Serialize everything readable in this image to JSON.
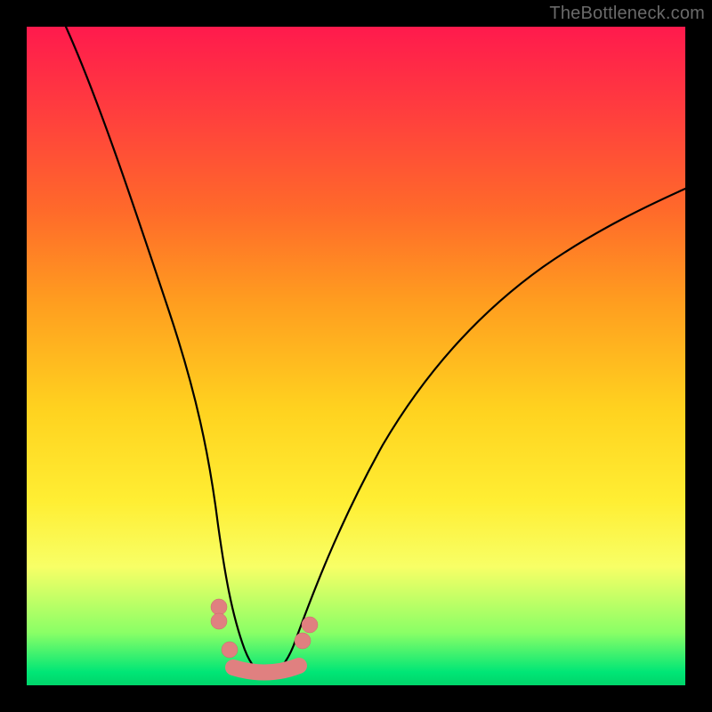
{
  "watermark": "TheBottleneck.com",
  "chart_data": {
    "type": "line",
    "title": "",
    "xlabel": "",
    "ylabel": "",
    "xlim": [
      0,
      100
    ],
    "ylim": [
      0,
      100
    ],
    "grid": false,
    "legend": false,
    "series": [
      {
        "name": "left-curve",
        "x": [
          6,
          10,
          14,
          18,
          22,
          25,
          27,
          28.5,
          30,
          31.5,
          33,
          36
        ],
        "y": [
          100,
          88,
          74,
          58,
          40,
          25,
          15,
          10,
          6,
          4,
          2.5,
          2
        ]
      },
      {
        "name": "right-curve",
        "x": [
          36,
          38,
          40,
          43,
          47,
          52,
          58,
          65,
          74,
          84,
          96,
          100
        ],
        "y": [
          2,
          3,
          5,
          10,
          18,
          28,
          38,
          48,
          58,
          66,
          73,
          76
        ]
      }
    ],
    "minimum_band": {
      "x": [
        30,
        40
      ],
      "y": 2
    },
    "dots_left": [
      {
        "x": 28.5,
        "y": 10
      },
      {
        "x": 28.5,
        "y": 8
      },
      {
        "x": 30.5,
        "y": 4.5
      }
    ],
    "dots_right": [
      {
        "x": 41,
        "y": 8
      },
      {
        "x": 42,
        "y": 10
      }
    ],
    "colors": {
      "gradient_top": "#ff1a4d",
      "gradient_bottom": "#00d46a",
      "curve": "#000000",
      "marker": "#e08080"
    }
  }
}
